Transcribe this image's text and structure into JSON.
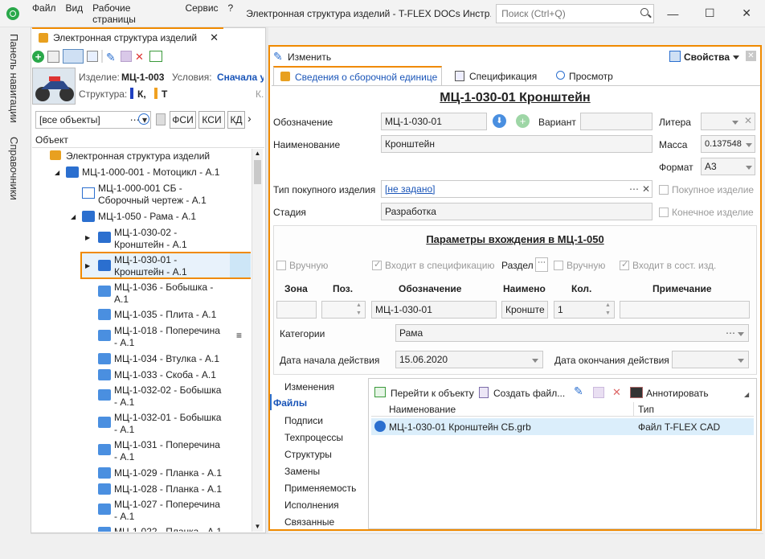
{
  "menu": [
    "Файл",
    "Вид",
    "Рабочие страницы",
    "Сервис",
    "?"
  ],
  "window_title": "Электронная структура изделий - T-FLEX DOCs Инстр...",
  "search_placeholder": "Поиск (Ctrl+Q)",
  "nav_strip": [
    "Панель навигации",
    "Справочники"
  ],
  "doc_tab": "Электронная структура изделий",
  "product_header": {
    "izdelie_label": "Изделие:",
    "izdelie_value": "МЦ-1-003",
    "usloviya_label": "Условия:",
    "usloviya_value": "Сначала у",
    "struktura_label": "Структура:",
    "struktura_k": "К,",
    "struktura_t": "Т",
    "extra": "К."
  },
  "filter": {
    "value": "[все объекты]",
    "buttons": [
      "ФСИ",
      "КСИ",
      "КД"
    ]
  },
  "tree_header": "Объект",
  "tree": [
    {
      "text": "Электронная структура изделий"
    },
    {
      "text": "МЦ-1-000-001 - Мотоцикл - А.1"
    },
    {
      "text": "МЦ-1-000-001 СБ -"
    },
    {
      "text": "Сборочный чертеж - А.1"
    },
    {
      "text": "МЦ-1-050 - Рама - А.1"
    },
    {
      "text": "МЦ-1-030-02 -"
    },
    {
      "text": "Кронштейн - А.1"
    },
    {
      "text": "МЦ-1-030-01 -"
    },
    {
      "text": "Кронштейн - А.1"
    },
    {
      "text": "МЦ-1-036 - Бобышка -"
    },
    {
      "text": "А.1"
    },
    {
      "text": "МЦ-1-035 - Плита - А.1"
    },
    {
      "text": "МЦ-1-018 - Поперечина"
    },
    {
      "text": "- А.1"
    },
    {
      "text": "МЦ-1-034 - Втулка - А.1"
    },
    {
      "text": "МЦ-1-033 - Скоба - А.1"
    },
    {
      "text": "МЦ-1-032-02 - Бобышка"
    },
    {
      "text": "- А.1"
    },
    {
      "text": "МЦ-1-032-01 - Бобышка"
    },
    {
      "text": "- А.1"
    },
    {
      "text": "МЦ-1-031 - Поперечина"
    },
    {
      "text": "- А.1"
    },
    {
      "text": "МЦ-1-029 - Планка - А.1"
    },
    {
      "text": "МЦ-1-028 - Планка - А.1"
    },
    {
      "text": "МЦ-1-027 - Поперечина"
    },
    {
      "text": "- А.1"
    },
    {
      "text": "МЦ-1-022 - Планка - А.1"
    }
  ],
  "right": {
    "edit_button": "Изменить",
    "props_button": "Свойства",
    "tabs": [
      "Сведения о сборочной единице",
      "Спецификация",
      "Просмотр"
    ],
    "title": "МЦ-1-030-01 Кронштейн",
    "oboznachenie_label": "Обозначение",
    "oboznachenie_value": "МЦ-1-030-01",
    "variant_label": "Вариант",
    "litera_label": "Литера",
    "naimenovanie_label": "Наименование",
    "naimenovanie_value": "Кронштейн",
    "massa_label": "Масса",
    "massa_value": "0.137548",
    "format_label": "Формат",
    "format_value": "А3",
    "tip_label": "Тип покупного изделия",
    "tip_value": "[не задано]",
    "pokupnoe": "Покупное изделие",
    "stadiya_label": "Стадия",
    "stadiya_value": "Разработка",
    "konechnoe": "Конечное изделие",
    "params_title": "Параметры вхождения в МЦ-1-050",
    "vruchnuyu1": "Вручную",
    "vhodit_spec": "Входит в спецификацию",
    "razdel": "Раздел",
    "vruchnuyu2": "Вручную",
    "vhodit_sost": "Входит в сост. изд.",
    "cols": [
      "Зона",
      "Поз.",
      "Обозначение",
      "Наимено",
      "Кол.",
      "Примечание"
    ],
    "row_oboz": "МЦ-1-030-01",
    "row_naim": "Кронште",
    "row_kol": "1",
    "kategorii_label": "Категории",
    "kategorii_value": "Рама",
    "date_start_label": "Дата начала действия",
    "date_start_value": "15.06.2020",
    "date_end_label": "Дата окончания действия",
    "side_tabs": [
      "Изменения",
      "Файлы",
      "Подписи",
      "Техпроцессы",
      "Структуры",
      "Замены",
      "Применяемость",
      "Исполнения",
      "Связанные"
    ],
    "files_toolbar": [
      "Перейти к объекту",
      "Создать файл...",
      "Аннотировать"
    ],
    "files_cols": [
      "Наименование",
      "Тип"
    ],
    "files_row": {
      "name": "МЦ-1-030-01 Кронштейн СБ.grb",
      "type": "Файл T-FLEX CAD"
    }
  },
  "colors": {
    "accent": "#f08a00",
    "selected": "#cde6f7",
    "link": "#1a55b8"
  }
}
